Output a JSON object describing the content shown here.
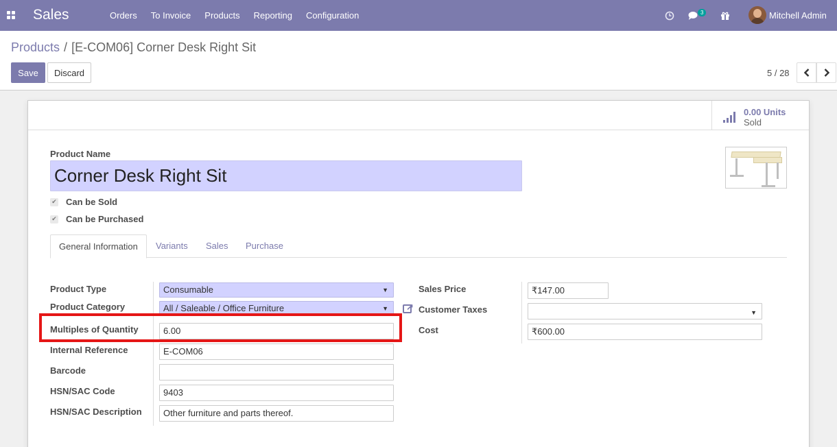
{
  "navbar": {
    "brand": "Sales",
    "menu": [
      "Orders",
      "To Invoice",
      "Products",
      "Reporting",
      "Configuration"
    ],
    "messages_count": "3",
    "user_name": "Mitchell Admin"
  },
  "breadcrumb": {
    "parent": "Products",
    "current": "[E-COM06] Corner Desk Right Sit"
  },
  "buttons": {
    "save": "Save",
    "discard": "Discard"
  },
  "pager": {
    "value": "5 / 28"
  },
  "stat_button": {
    "value": "0.00 Units",
    "label": "Sold"
  },
  "product": {
    "name_label": "Product Name",
    "name": "Corner Desk Right Sit",
    "can_be_sold": "Can be Sold",
    "can_be_purchased": "Can be Purchased"
  },
  "tabs": [
    "General Information",
    "Variants",
    "Sales",
    "Purchase"
  ],
  "left_fields": {
    "product_type": {
      "label": "Product Type",
      "value": "Consumable"
    },
    "product_category": {
      "label": "Product Category",
      "value": "All / Saleable / Office Furniture"
    },
    "multiples_of_quantity": {
      "label": "Multiples of Quantity",
      "value": "6.00"
    },
    "internal_reference": {
      "label": "Internal Reference",
      "value": "E-COM06"
    },
    "barcode": {
      "label": "Barcode",
      "value": ""
    },
    "hsn_code": {
      "label": "HSN/SAC Code",
      "value": "9403"
    },
    "hsn_description": {
      "label": "HSN/SAC Description",
      "value": "Other furniture and parts thereof."
    }
  },
  "right_fields": {
    "sales_price": {
      "label": "Sales Price",
      "value": "₹147.00"
    },
    "customer_taxes": {
      "label": "Customer Taxes",
      "value": ""
    },
    "cost": {
      "label": "Cost",
      "value": "₹600.00"
    }
  },
  "colors": {
    "brand": "#7c7bad",
    "required_field": "#d2d2ff",
    "highlight": "#e51616"
  }
}
